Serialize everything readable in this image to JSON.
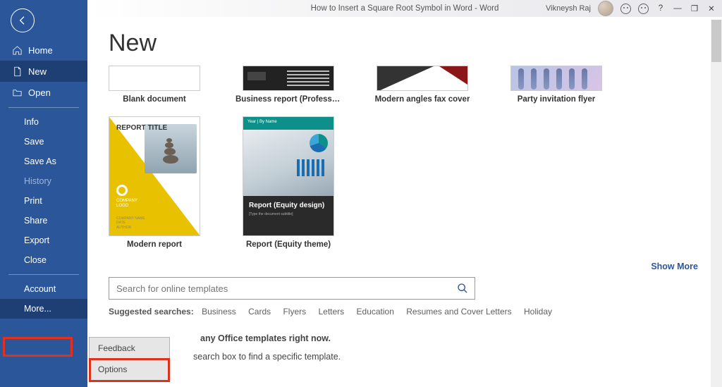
{
  "titlebar": {
    "document": "How to Insert a Square Root Symbol in Word  -  Word",
    "user": "Vikneysh Raj"
  },
  "sidebar": {
    "primary": [
      {
        "label": "Home",
        "icon": "home"
      },
      {
        "label": "New",
        "icon": "file"
      },
      {
        "label": "Open",
        "icon": "folder"
      }
    ],
    "secondary": [
      {
        "label": "Info"
      },
      {
        "label": "Save"
      },
      {
        "label": "Save As"
      },
      {
        "label": "History",
        "disabled": true
      },
      {
        "label": "Print"
      },
      {
        "label": "Share"
      },
      {
        "label": "Export"
      },
      {
        "label": "Close"
      }
    ],
    "footer": [
      {
        "label": "Account"
      },
      {
        "label": "More..."
      }
    ],
    "popup": [
      {
        "label": "Feedback"
      },
      {
        "label": "Options"
      }
    ]
  },
  "page": {
    "title": "New",
    "templates_row1": [
      {
        "label": "Blank document",
        "kind": "blank"
      },
      {
        "label": "Business report (Professiona...",
        "kind": "biz"
      },
      {
        "label": "Modern angles fax cover",
        "kind": "angle"
      },
      {
        "label": "Party invitation flyer",
        "kind": "party"
      }
    ],
    "templates_row2": [
      {
        "label": "Modern report",
        "kind": "modern"
      },
      {
        "label": "Report (Equity theme)",
        "kind": "equity"
      }
    ],
    "modern_report": {
      "title": "REPORT TITLE",
      "logo": "COMPANY\nLOGO",
      "footer": "COMPANY NAME\nDATE\nAUTHOR"
    },
    "equity_report": {
      "band": "Year | By  Name",
      "title": "Report (Equity design)",
      "subtitle": "[Type the document subtitle]"
    },
    "show_more": "Show More",
    "search_placeholder": "Search for online templates",
    "suggested_label": "Suggested searches:",
    "suggested": [
      "Business",
      "Cards",
      "Flyers",
      "Letters",
      "Education",
      "Resumes and Cover Letters",
      "Holiday"
    ],
    "msg_bold": "any Office templates right now.",
    "msg_line": "search box to find a specific template."
  }
}
